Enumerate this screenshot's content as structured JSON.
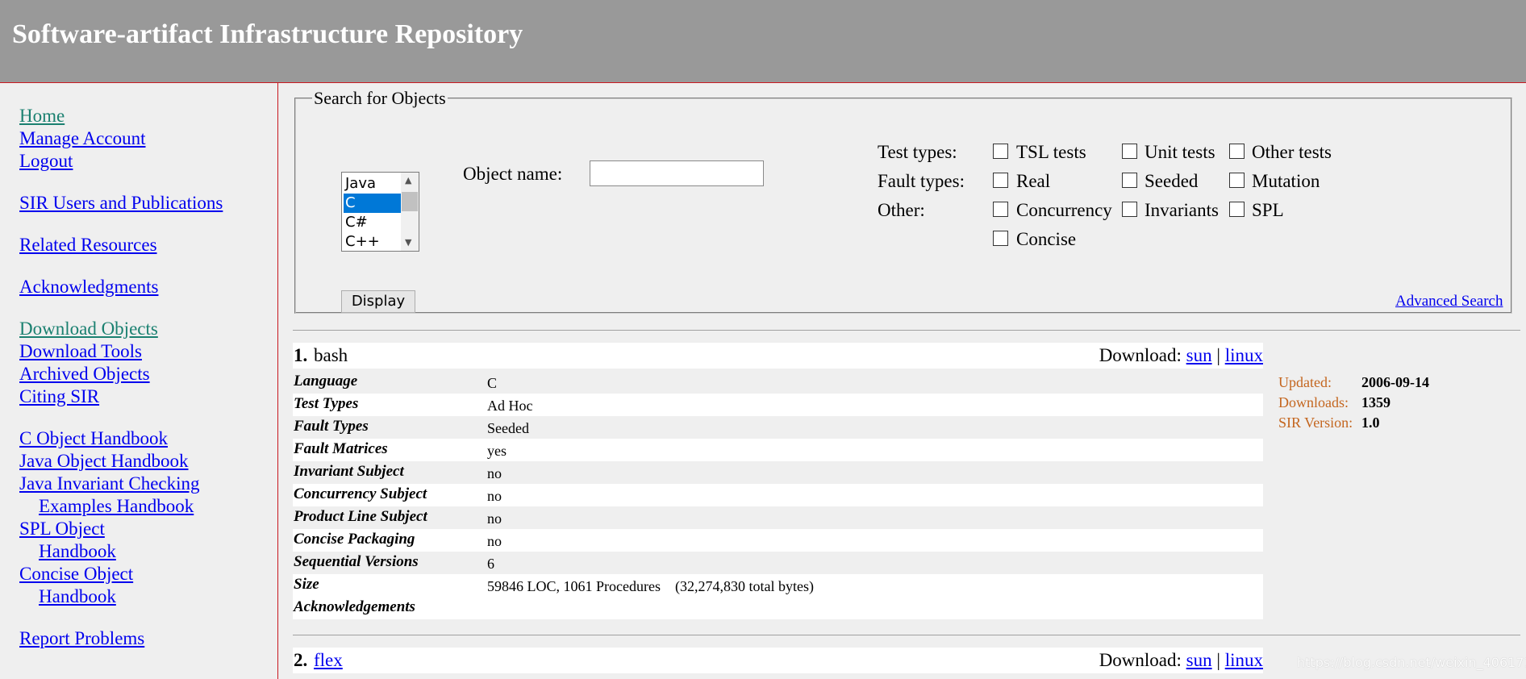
{
  "header": {
    "title": "Software-artifact Infrastructure Repository"
  },
  "sidebar": {
    "links": [
      "Home",
      "Manage Account",
      "Logout",
      "SIR Users and Publications",
      "Related Resources",
      "Acknowledgments",
      "Download Objects",
      "Download Tools",
      "Archived Objects",
      "Citing SIR",
      "C Object Handbook",
      "Java Object Handbook",
      "Java Invariant Checking",
      "Examples Handbook",
      "SPL Object",
      "Handbook",
      "Concise Object",
      "Handbook",
      "Report Problems"
    ]
  },
  "search": {
    "legend": "Search for Objects",
    "languages": [
      "Java",
      "C",
      "C#",
      "C++"
    ],
    "selected_language": "C",
    "object_name_label": "Object name:",
    "object_name_value": "",
    "display_button": "Display",
    "advanced_search": "Advanced Search",
    "test_types_label": "Test types:",
    "fault_types_label": "Fault types:",
    "other_label": "Other:",
    "test_types": [
      "TSL tests",
      "Unit tests",
      "Other tests"
    ],
    "fault_types": [
      "Real",
      "Seeded",
      "Mutation"
    ],
    "other": [
      "Concurrency",
      "Invariants",
      "SPL",
      "Concise"
    ]
  },
  "results": [
    {
      "number": "1.",
      "name": "bash",
      "download_label": "Download:",
      "download_sun": "sun",
      "download_sep": "|",
      "download_linux": "linux",
      "attributes": [
        {
          "k": "Language",
          "v": "C"
        },
        {
          "k": "Test Types",
          "v": "Ad Hoc"
        },
        {
          "k": "Fault Types",
          "v": "Seeded"
        },
        {
          "k": "Fault Matrices",
          "v": "yes"
        },
        {
          "k": "Invariant Subject",
          "v": "no"
        },
        {
          "k": "Concurrency Subject",
          "v": "no"
        },
        {
          "k": "Product Line Subject",
          "v": "no"
        },
        {
          "k": "Concise Packaging",
          "v": "no"
        },
        {
          "k": "Sequential Versions",
          "v": "6"
        },
        {
          "k": "Size",
          "v": "59846 LOC, 1061 Procedures    (32,274,830 total bytes)"
        },
        {
          "k": "Acknowledgements",
          "v": ""
        }
      ],
      "meta": {
        "updated_label": "Updated:",
        "updated": "2006-09-14",
        "downloads_label": "Downloads:",
        "downloads": "1359",
        "version_label": "SIR Version:",
        "version": "1.0"
      }
    },
    {
      "number": "2.",
      "name": "flex",
      "download_label": "Download:",
      "download_sun": "sun",
      "download_sep": "|",
      "download_linux": "linux"
    }
  ],
  "watermark": "https://blog.csdn.net/weixin_40617102",
  "colors": {
    "header_bg": "#999999",
    "accent_border": "#c8171f",
    "link": "#0000ee",
    "visited_link": "#1a8070",
    "meta_key": "#c4661f"
  }
}
